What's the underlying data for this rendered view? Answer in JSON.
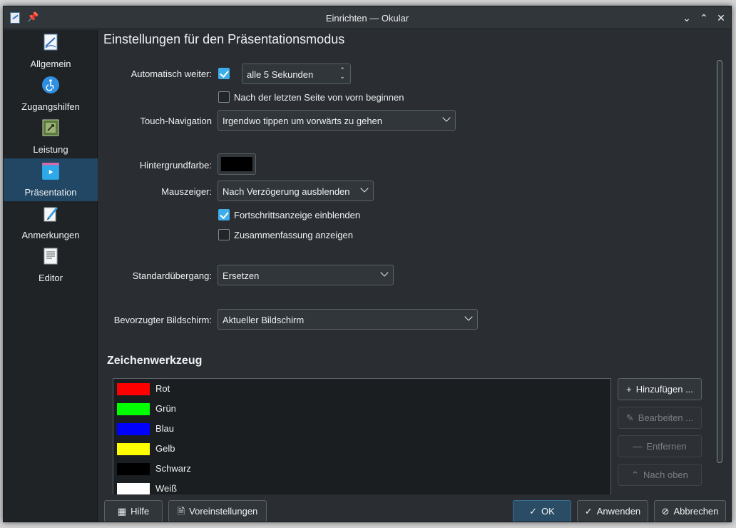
{
  "window": {
    "title": "Einrichten — Okular"
  },
  "sidebar": {
    "items": [
      {
        "label": "Allgemein",
        "icon": "general-icon"
      },
      {
        "label": "Zugangshilfen",
        "icon": "accessibility-icon"
      },
      {
        "label": "Leistung",
        "icon": "performance-icon"
      },
      {
        "label": "Präsentation",
        "icon": "presentation-icon",
        "active": true
      },
      {
        "label": "Anmerkungen",
        "icon": "annotations-icon"
      },
      {
        "label": "Editor",
        "icon": "editor-icon"
      }
    ]
  },
  "main": {
    "title": "Einstellungen für den Präsentationsmodus",
    "auto_advance": {
      "label": "Automatisch weiter:",
      "checked": true,
      "interval": "alle 5 Sekunden"
    },
    "loop": {
      "label": "Nach der letzten Seite von vorn beginnen",
      "checked": false
    },
    "touch_nav": {
      "label": "Touch-Navigation",
      "value": "Irgendwo tippen um vorwärts zu gehen"
    },
    "background": {
      "label": "Hintergrundfarbe:",
      "color": "#000000"
    },
    "mouse": {
      "label": "Mauszeiger:",
      "value": "Nach Verzögerung ausblenden"
    },
    "progress": {
      "label": "Fortschrittsanzeige einblenden",
      "checked": true
    },
    "summary": {
      "label": "Zusammenfassung anzeigen",
      "checked": false
    },
    "transition": {
      "label": "Standardübergang:",
      "value": "Ersetzen"
    },
    "screen": {
      "label": "Bevorzugter Bildschirm:",
      "value": "Aktueller Bildschirm"
    },
    "drawing": {
      "heading": "Zeichenwerkzeug",
      "tools": [
        {
          "name": "Rot",
          "color": "#ff0000"
        },
        {
          "name": "Grün",
          "color": "#00ff00"
        },
        {
          "name": "Blau",
          "color": "#0000ff"
        },
        {
          "name": "Gelb",
          "color": "#ffff00"
        },
        {
          "name": "Schwarz",
          "color": "#000000"
        },
        {
          "name": "Weiß",
          "color": "#ffffff"
        }
      ],
      "buttons": {
        "add": "Hinzufügen ...",
        "edit": "Bearbeiten ...",
        "remove": "Entfernen",
        "move_up": "Nach oben"
      }
    }
  },
  "footer": {
    "help": "Hilfe",
    "defaults": "Voreinstellungen",
    "ok": "OK",
    "apply": "Anwenden",
    "cancel": "Abbrechen"
  }
}
